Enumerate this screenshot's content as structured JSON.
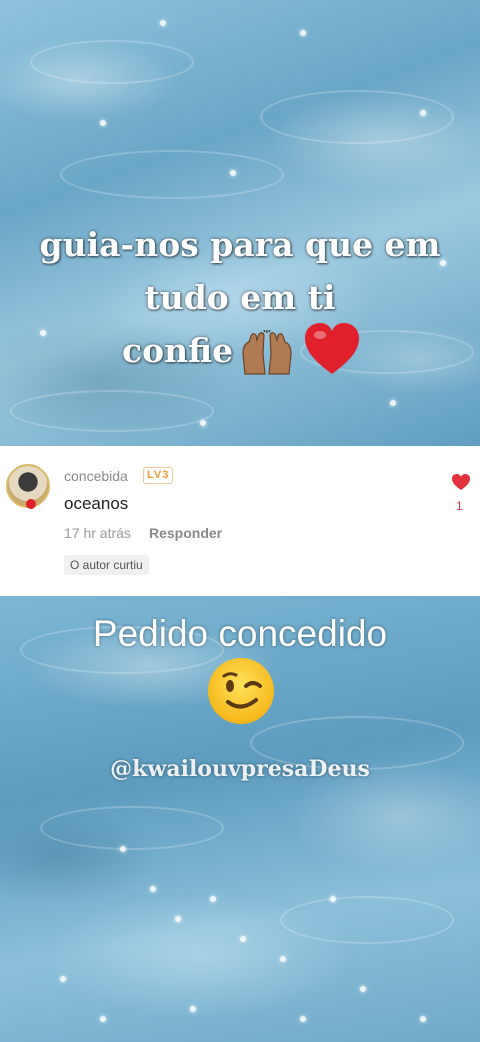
{
  "top_caption": {
    "line1": "guia-nos para que em",
    "line2": "tudo em ti",
    "line3": "confie"
  },
  "comment": {
    "username": "concebida",
    "level_badge": "LV3",
    "text": "oceanos",
    "time": "17 hr atrás",
    "reply_label": "Responder",
    "author_liked_label": "O autor curtiu",
    "like_count": "1",
    "like_color": "#e2323b"
  },
  "bottom_caption": {
    "title": "Pedido concedido",
    "watermark": "@kwailouvpresaDeus"
  },
  "icons": {
    "hands": "raising-hands-icon",
    "heart": "red-heart-icon",
    "wink": "winking-face-icon",
    "like": "heart-icon"
  }
}
